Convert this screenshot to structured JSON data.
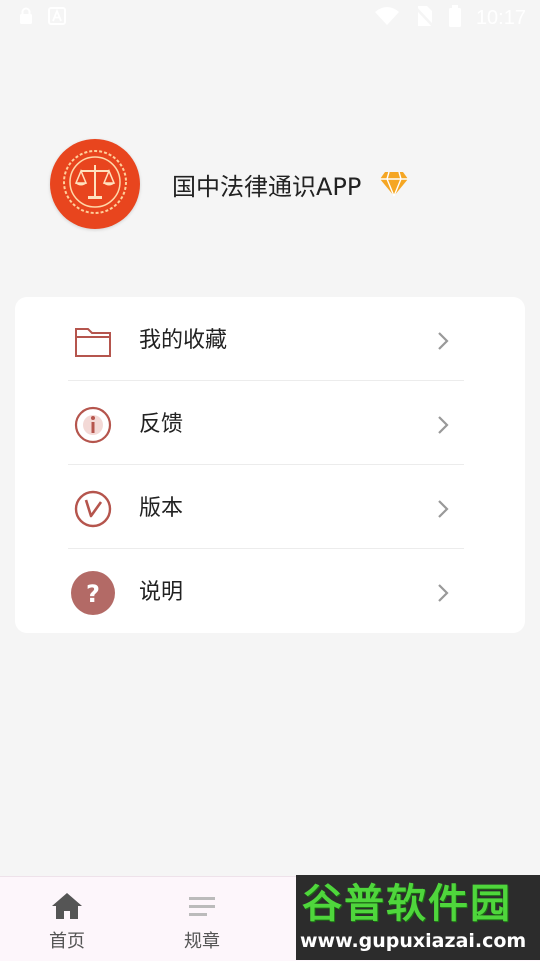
{
  "status_bar": {
    "time": "10:17",
    "icons": [
      "lock-icon",
      "a-icon",
      "wifi-icon",
      "no-sim-icon",
      "battery-icon"
    ]
  },
  "profile": {
    "app_name": "国中法律通识APP",
    "avatar_icon": "scales-of-justice-icon",
    "badge_icon": "diamond-icon"
  },
  "menu": {
    "items": [
      {
        "label": "我的收藏",
        "icon": "folder-icon"
      },
      {
        "label": "反馈",
        "icon": "info-icon"
      },
      {
        "label": "版本",
        "icon": "version-check-icon"
      },
      {
        "label": "说明",
        "icon": "question-icon"
      }
    ]
  },
  "bottom_nav": {
    "items": [
      {
        "label": "首页",
        "icon": "home-icon"
      },
      {
        "label": "规章",
        "icon": "list-icon"
      }
    ]
  },
  "watermark": {
    "title": "谷普软件园",
    "url": "www.gupuxiazai.com"
  },
  "colors": {
    "avatar_bg": "#e8451e",
    "icon_accent": "#b5554d",
    "badge": "#f5a623",
    "watermark_green": "#4fd63c"
  }
}
